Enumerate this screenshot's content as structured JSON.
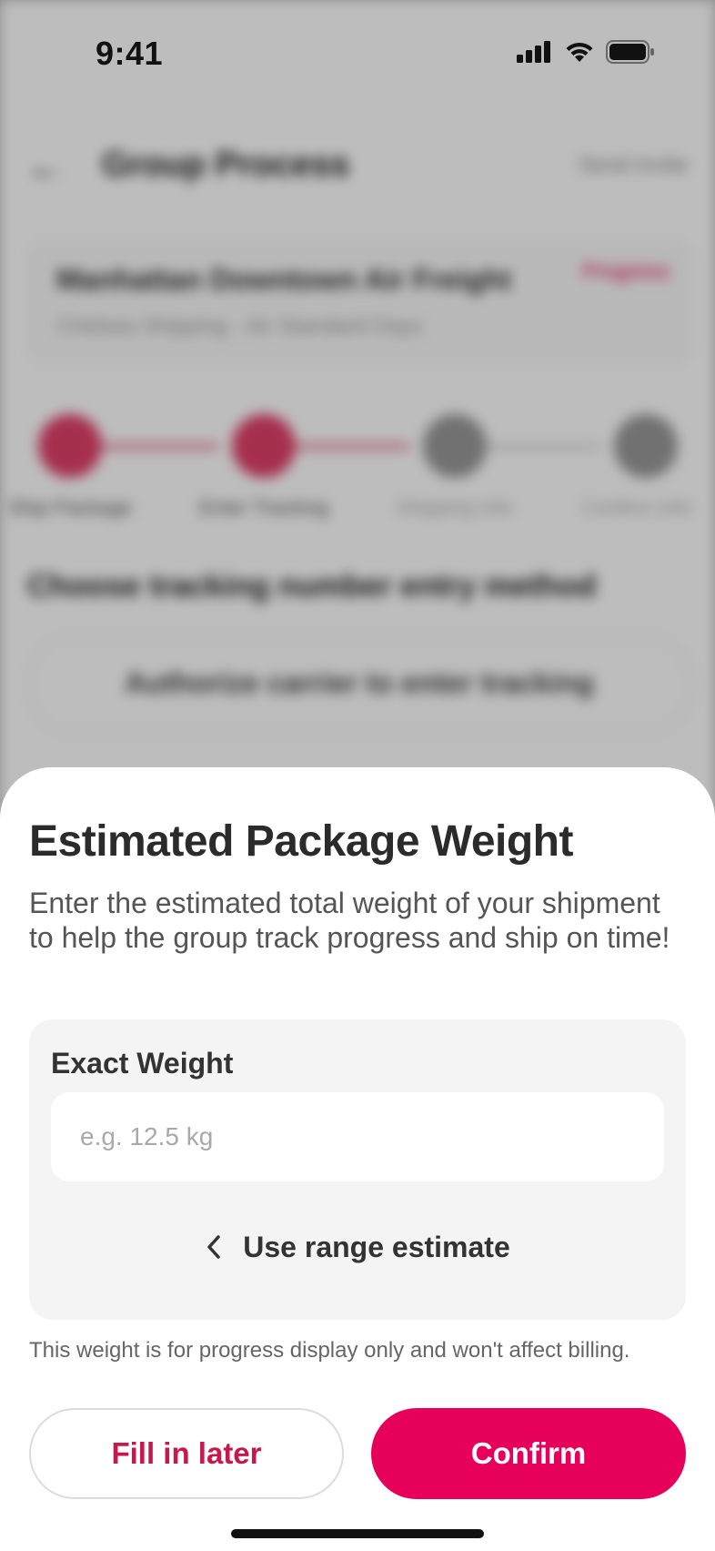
{
  "status_bar": {
    "time": "9:41"
  },
  "background": {
    "header_title": "Group Process",
    "header_right": "Send Invite",
    "card_title": "Manhattan Downtown Air Freight",
    "card_subtitle": "Chelsea Shipping - Air Standard Days",
    "card_tag": "Progress",
    "steps": [
      "Ship Package",
      "Enter Tracking",
      "Shipping Info",
      "Confirm Info"
    ],
    "section_title": "Choose tracking number entry method",
    "option_label": "Authorize carrier to enter tracking"
  },
  "sheet": {
    "title": "Estimated Package Weight",
    "description": "Enter the estimated total weight of your shipment to help the group track progress and ship on time!",
    "field_label": "Exact Weight",
    "input_placeholder": "e.g. 12.5 kg",
    "input_value": "",
    "range_toggle_label": "Use range estimate",
    "note": "This weight is for progress display only and won't affect billing.",
    "fill_later_label": "Fill in later",
    "confirm_label": "Confirm"
  },
  "colors": {
    "accent": "#e6005a",
    "accent_text": "#c8174a",
    "panel_bg": "#f4f4f4",
    "title_text": "#2b2b2b"
  },
  "icons": {
    "back": "arrow-left-icon",
    "range_toggle": "chevron-left-icon",
    "signal": "cellular-signal-icon",
    "wifi": "wifi-icon",
    "battery": "battery-icon"
  }
}
